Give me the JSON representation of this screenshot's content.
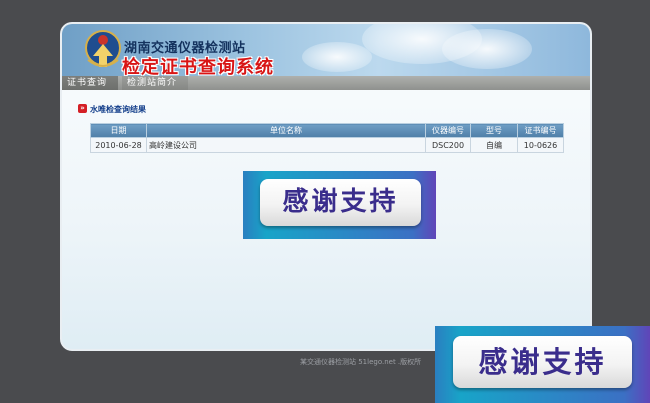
{
  "header": {
    "station_name": "湖南交通仪器检测站",
    "system_title": "检定证书查询系统"
  },
  "tabs": [
    {
      "label": "证书查询"
    },
    {
      "label": "检测站简介"
    }
  ],
  "results": {
    "title": "水唯检查询结果",
    "columns": [
      "日期",
      "单位名称",
      "仪器编号",
      "型号",
      "证书编号"
    ],
    "rows": [
      [
        "2010-06-28",
        "高岭建设公司",
        "DSC200",
        "自编",
        "10-0626"
      ]
    ]
  },
  "banners": {
    "thanks_text": "感谢支持"
  },
  "footer": {
    "text": "某交通仪器检测站 51lego.net .版权所"
  },
  "colors": {
    "background": "#4a4b4e",
    "header_blue": "#6f9fc6",
    "system_title_red": "#d81515",
    "table_header": "#4f7fa8"
  },
  "icons": {
    "emblem": "traffic-emblem-icon",
    "bullet": "arrow-bullet-icon"
  }
}
